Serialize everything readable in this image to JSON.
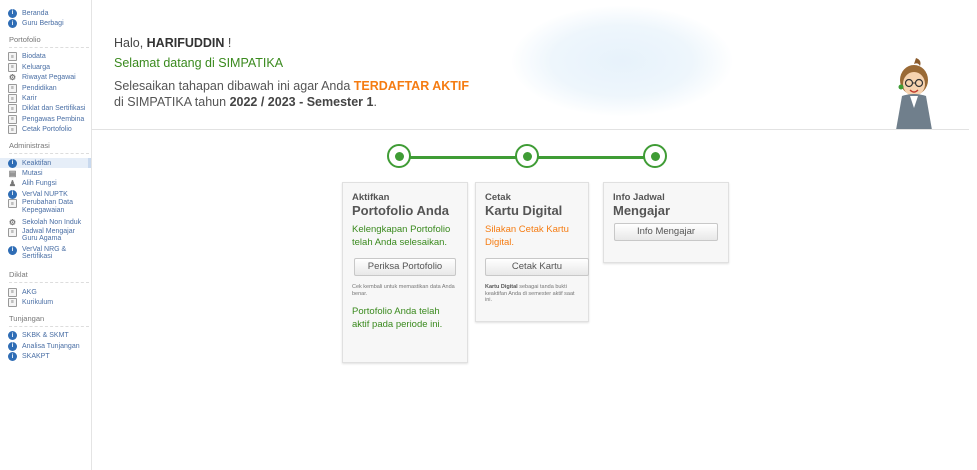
{
  "sidebar": {
    "top": [
      {
        "icon": "info",
        "label": "Beranda"
      },
      {
        "icon": "info",
        "label": "Guru Berbagi"
      }
    ],
    "sections": [
      {
        "title": "Portofolio",
        "items": [
          {
            "icon": "doc",
            "label": "Biodata"
          },
          {
            "icon": "doc",
            "label": "Keluarga"
          },
          {
            "icon": "glyph",
            "glyph": "⚙",
            "label": "Riwayat Pegawai"
          },
          {
            "icon": "doc",
            "label": "Pendidikan"
          },
          {
            "icon": "doc",
            "label": "Karir"
          },
          {
            "icon": "doc",
            "label": "Diklat dan Sertifikasi"
          },
          {
            "icon": "doc",
            "label": "Pengawas Pembina"
          },
          {
            "icon": "doc",
            "label": "Cetak Portofolio"
          }
        ]
      },
      {
        "title": "Administrasi",
        "items": [
          {
            "icon": "info",
            "label": "Keaktifan",
            "active": true
          },
          {
            "icon": "glyph",
            "glyph": "▤",
            "label": "Mutasi"
          },
          {
            "icon": "glyph",
            "glyph": "♟",
            "label": "Alih Fungsi"
          },
          {
            "icon": "info",
            "label": "VerVal NUPTK"
          },
          {
            "icon": "doc",
            "label": "Perubahan Data Kepegawaian",
            "two": true
          },
          {
            "icon": "glyph",
            "glyph": "⚙",
            "label": "Sekolah Non Induk"
          },
          {
            "icon": "doc",
            "label": "Jadwal Mengajar Guru Agama",
            "two": true
          },
          {
            "icon": "info",
            "label": "VerVal NRG & Sertifikasi",
            "two": true
          }
        ]
      },
      {
        "title": "Diklat",
        "items": [
          {
            "icon": "doc",
            "label": "AKG"
          },
          {
            "icon": "doc",
            "label": "Kurikulum"
          }
        ]
      },
      {
        "title": "Tunjangan",
        "items": [
          {
            "icon": "info",
            "label": "SKBK & SKMT"
          },
          {
            "icon": "info",
            "label": "Analisa Tunjangan"
          },
          {
            "icon": "info",
            "label": "SKAKPT"
          }
        ]
      }
    ]
  },
  "header": {
    "greeting_prefix": "Halo, ",
    "user_name": "HARIFUDDIN",
    "greeting_suffix": " !",
    "welcome": "Selamat datang di SIMPATIKA",
    "instr_1": "Selesaikan tahapan dibawah ini agar Anda ",
    "instr_highlight": "TERDAFTAR AKTIF",
    "instr_2": "di SIMPATIKA tahun ",
    "instr_year": "2022 / 2023 - Semester 1",
    "instr_end": "."
  },
  "cards": {
    "portfolio": {
      "title1": "Aktifkan",
      "title2": "Portofolio Anda",
      "status": "Kelengkapan Portofolio telah Anda selesaikan.",
      "button": "Periksa Portofolio",
      "note": "Cek kembali untuk memastikan data Anda benar.",
      "footer": "Portofolio Anda telah aktif pada periode ini."
    },
    "kartu": {
      "title1": "Cetak",
      "title2": "Kartu Digital",
      "status": "Silakan Cetak Kartu Digital.",
      "button": "Cetak Kartu",
      "note_bold": "Kartu Digital",
      "note": " sebagai tanda bukti keaktifan Anda di semester aktif saat ini."
    },
    "jadwal": {
      "title1": "Info Jadwal",
      "title2": "Mengajar",
      "button": "Info Mengajar"
    }
  },
  "colors": {
    "accent_green": "#3f9c35",
    "highlight_orange": "#f57c12",
    "link_blue": "#4a6fa5"
  }
}
